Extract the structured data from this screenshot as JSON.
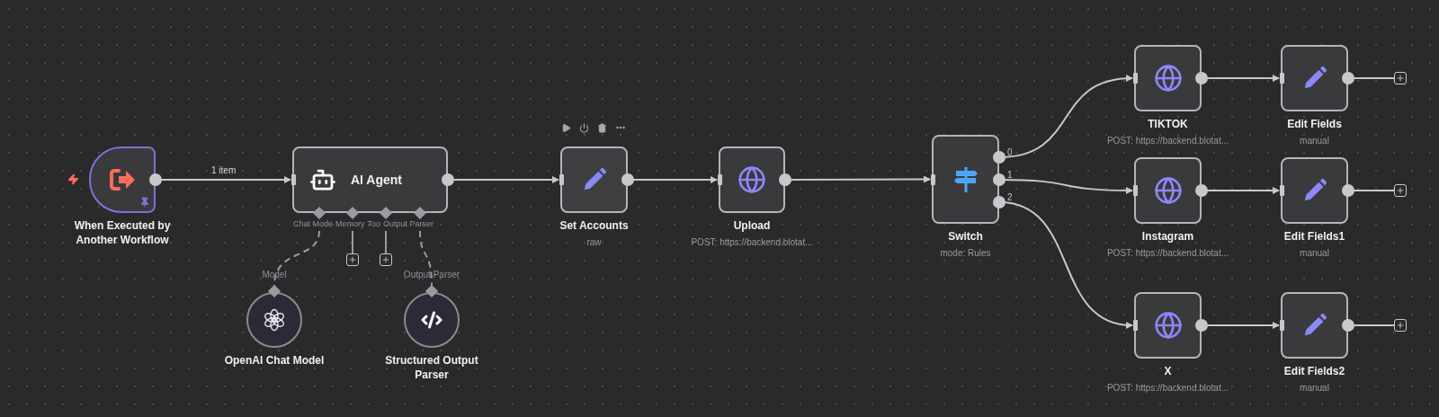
{
  "canvas": {
    "nodes": [
      {
        "kind": "trigger",
        "name": "When Executed by Another Workflow",
        "pinned": true,
        "output_label": "1 item"
      },
      {
        "kind": "agent",
        "name": "AI Agent",
        "inputs": [
          {
            "label": "Chat Mode",
            "connected": true
          },
          {
            "label": "Memory",
            "connected": false
          },
          {
            "label": "Too",
            "connected": false
          },
          {
            "label": "Output Parser",
            "connected": true
          }
        ]
      },
      {
        "kind": "action",
        "name": "Set Accounts",
        "subtitle": "raw",
        "hovered": true
      },
      {
        "kind": "action",
        "name": "Upload",
        "subtitle": "POST: https://backend.blotat..."
      },
      {
        "kind": "switch",
        "name": "Switch",
        "subtitle": "mode: Rules",
        "outputs": [
          "0",
          "1",
          "2"
        ]
      },
      {
        "kind": "action",
        "name": "TIKTOK",
        "subtitle": "POST: https://backend.blotat..."
      },
      {
        "kind": "action",
        "name": "Edit Fields",
        "subtitle": "manual",
        "open_end": true
      },
      {
        "kind": "action",
        "name": "Instagram",
        "subtitle": "POST: https://backend.blotat..."
      },
      {
        "kind": "action",
        "name": "Edit Fields1",
        "subtitle": "manual",
        "open_end": true
      },
      {
        "kind": "action",
        "name": "X",
        "subtitle": "POST: https://backend.blotat..."
      },
      {
        "kind": "action",
        "name": "Edit Fields2",
        "subtitle": "manual",
        "open_end": true
      },
      {
        "kind": "sub",
        "name": "OpenAI Chat Model",
        "slot": "Model"
      },
      {
        "kind": "sub",
        "name": "Structured Output Parser",
        "slot": "Output Parser"
      }
    ]
  }
}
